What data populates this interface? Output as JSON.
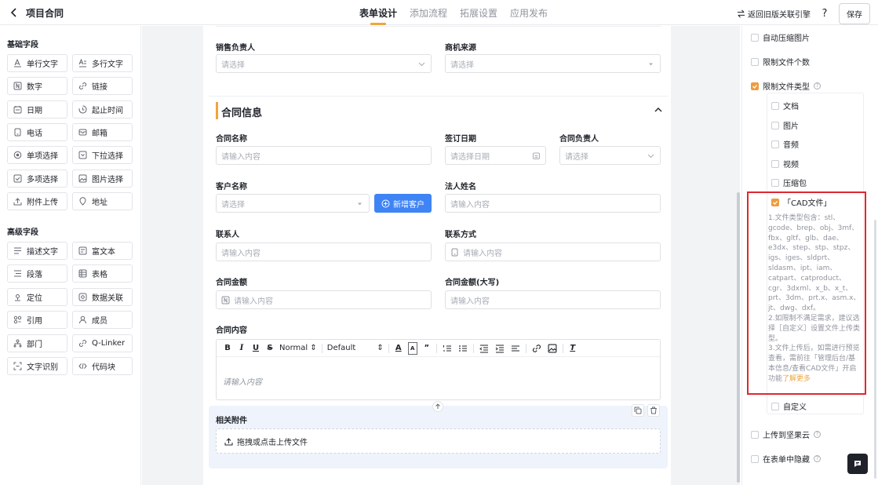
{
  "header": {
    "app_title": "项目合同",
    "tabs": [
      "表单设计",
      "添加流程",
      "拓展设置",
      "应用发布"
    ],
    "legacy_link": "返回旧版关联引擎",
    "help": "?",
    "save_label": "保存"
  },
  "left_panel": {
    "basic_title": "基础字段",
    "basic_fields": [
      "单行文字",
      "多行文字",
      "数字",
      "链接",
      "日期",
      "起止时间",
      "电话",
      "邮箱",
      "单项选择",
      "下拉选择",
      "多项选择",
      "图片选择",
      "附件上传",
      "地址"
    ],
    "advanced_title": "高级字段",
    "advanced_fields": [
      "描述文字",
      "富文本",
      "段落",
      "表格",
      "定位",
      "数据关联",
      "引用",
      "成员",
      "部门",
      "Q-Linker",
      "文字识别",
      "代码块"
    ]
  },
  "form": {
    "sales_owner_label": "销售负责人",
    "sales_owner_ph": "请选择",
    "lead_source_label": "商机来源",
    "lead_source_ph": "请选择",
    "section_title": "合同信息",
    "contract_name_label": "合同名称",
    "contract_name_ph": "请输入内容",
    "sign_date_label": "签订日期",
    "sign_date_ph": "请选择日期",
    "contract_owner_label": "合同负责人",
    "contract_owner_ph": "请选择",
    "customer_label": "客户名称",
    "customer_ph": "请选择",
    "add_customer_label": "新增客户",
    "legal_label": "法人姓名",
    "legal_ph": "请输入内容",
    "contact_label": "联系人",
    "contact_ph": "请输入内容",
    "phone_label": "联系方式",
    "phone_ph": "请输入内容",
    "amount_label": "合同金额",
    "amount_ph": "请输入内容",
    "amount_cn_label": "合同金额(大写)",
    "amount_cn_ph": "请输入内容",
    "content_label": "合同内容",
    "rte_normal": "Normal",
    "rte_font": "Default",
    "rte_ph": "请输入内容",
    "attach_label": "相关附件",
    "upload_label": "拖拽或点击上传文件"
  },
  "right_panel": {
    "auto_compress": "自动压缩图片",
    "limit_count": "限制文件个数",
    "limit_type": "限制文件类型",
    "types": [
      "文档",
      "图片",
      "音频",
      "视频",
      "压缩包"
    ],
    "cad": "「CAD文件」",
    "cad_desc_1": "1.文件类型包含：stl、gcode、brep、obj、3mf、fbx、gltf、glb、dae、e3dx、step、stp、stpz、igs、iges、sldprt、sldasm、ipt、iam、catpart、catproduct、cgr、3dxml、x_b、x_t、prt、3dm、prt.x、asm.x、jt、dwg、dxf。",
    "cad_desc_2": "2.如限制不满足需求，建议选择［自定义］设置文件上传类型。",
    "cad_desc_3": "3.文件上传后，如需进行预览查看，需前往「管理后台/基本信息/查看CAD文件」开启功能",
    "learn_more": "了解更多",
    "custom": "自定义",
    "upload_cloud": "上传到坚果云",
    "hide_in_form": "在表单中隐藏"
  },
  "colors": {
    "accent": "#f0a53d",
    "primary": "#3f84f5",
    "highlight": "#e0262f"
  }
}
